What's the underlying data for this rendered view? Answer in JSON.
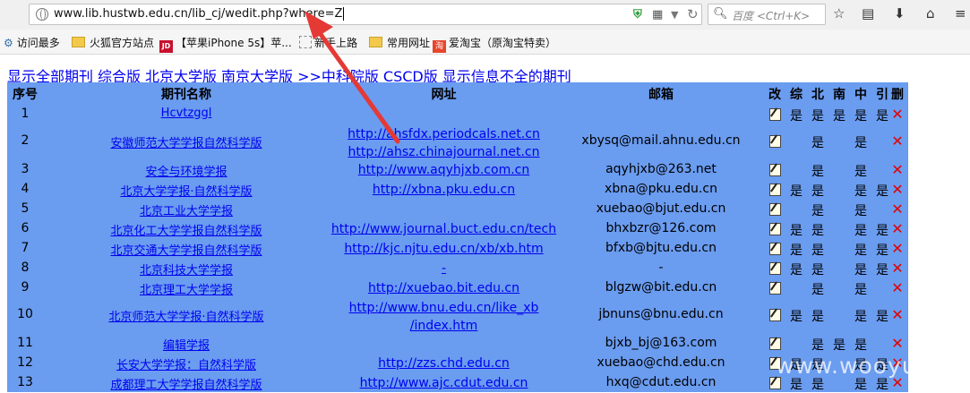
{
  "browser": {
    "url": "www.lib.hustwb.edu.cn/lib_cj/wedit.php?where=Z",
    "search_placeholder": "百度 <Ctrl+K>",
    "icons": [
      "globe-icon",
      "shield-icon",
      "qr-icon",
      "dropdown-icon",
      "reload-icon",
      "search-icon",
      "star-icon",
      "reading-list-icon",
      "download-icon",
      "home-icon",
      "menu-icon"
    ]
  },
  "bookmarks": [
    {
      "label": "访问最多",
      "icon": "gear-icon"
    },
    {
      "label": "火狐官方站点",
      "icon": "folder-icon"
    },
    {
      "label": "【苹果iPhone 5s】苹...",
      "icon": "jd-icon"
    },
    {
      "label": "新手上路",
      "icon": "page-icon"
    },
    {
      "label": "常用网址",
      "icon": "folder-icon"
    },
    {
      "label": "爱淘宝（原淘宝特卖）",
      "icon": "taobao-icon"
    }
  ],
  "filters": [
    "显示全部期刊",
    "综合版",
    "北京大学版",
    "南京大学版",
    ">>中科院版",
    "CSCD版",
    "显示信息不全的期刊"
  ],
  "columns": [
    "序号",
    "期刊名称",
    "网址",
    "邮箱",
    "改",
    "综",
    "北",
    "南",
    "中",
    "引",
    "删"
  ],
  "rows": [
    {
      "no": "1",
      "name": "Hcvtzggl",
      "url": [
        ""
      ],
      "email": "",
      "zh": "是",
      "bei": "是",
      "nan": "是",
      "zk": "是",
      "yin": "是"
    },
    {
      "no": "2",
      "name": "安徽师范大学学报自然科学版",
      "url": [
        "http://ahsfdx.periodcals.net.cn",
        "http://ahsz.chinajournal.net.cn"
      ],
      "email": "xbysq@mail.ahnu.edu.cn",
      "zh": "",
      "bei": "是",
      "nan": "",
      "zk": "是",
      "yin": ""
    },
    {
      "no": "3",
      "name": "安全与环境学报",
      "url": [
        "http://www.aqyhjxb.com.cn"
      ],
      "email": "aqyhjxb@263.net",
      "zh": "",
      "bei": "是",
      "nan": "",
      "zk": "是",
      "yin": ""
    },
    {
      "no": "4",
      "name": "北京大学学报·自然科学版",
      "url": [
        "http://xbna.pku.edu.cn"
      ],
      "email": "xbna@pku.edu.cn",
      "zh": "是",
      "bei": "是",
      "nan": "",
      "zk": "是",
      "yin": "是"
    },
    {
      "no": "5",
      "name": "北京工业大学学报",
      "url": [
        ""
      ],
      "email": "xuebao@bjut.edu.cn",
      "zh": "",
      "bei": "是",
      "nan": "",
      "zk": "是",
      "yin": ""
    },
    {
      "no": "6",
      "name": "北京化工大学学报自然科学版",
      "url": [
        "http://www.journal.buct.edu.cn/tech"
      ],
      "email": "bhxbzr@126.com",
      "zh": "是",
      "bei": "是",
      "nan": "",
      "zk": "是",
      "yin": "是"
    },
    {
      "no": "7",
      "name": "北京交通大学学报自然科学版",
      "url": [
        "http://kjc.njtu.edu.cn/xb/xb.htm"
      ],
      "email": "bfxb@bjtu.edu.cn",
      "zh": "是",
      "bei": "是",
      "nan": "",
      "zk": "是",
      "yin": "是"
    },
    {
      "no": "8",
      "name": "北京科技大学学报",
      "url": [
        "-"
      ],
      "email": "-",
      "zh": "是",
      "bei": "是",
      "nan": "",
      "zk": "是",
      "yin": "是"
    },
    {
      "no": "9",
      "name": "北京理工大学学报",
      "url": [
        "http://xuebao.bit.edu.cn"
      ],
      "email": "blgzw@bit.edu.cn",
      "zh": "",
      "bei": "是",
      "nan": "",
      "zk": "是",
      "yin": ""
    },
    {
      "no": "10",
      "name": "北京师范大学学报·自然科学版",
      "url": [
        "http://www.bnu.edu.cn/like_xb",
        "/index.htm"
      ],
      "email": "jbnuns@bnu.edu.cn",
      "zh": "是",
      "bei": "是",
      "nan": "",
      "zk": "是",
      "yin": "是"
    },
    {
      "no": "11",
      "name": "编辑学报",
      "url": [
        ""
      ],
      "email": "bjxb_bj@163.com",
      "zh": "",
      "bei": "是",
      "nan": "是",
      "zk": "是",
      "yin": ""
    },
    {
      "no": "12",
      "name": "长安大学学报：自然科学版",
      "url": [
        "http://zzs.chd.edu.cn"
      ],
      "email": "xuebao@chd.edu.cn",
      "zh": "是",
      "bei": "是",
      "nan": "",
      "zk": "是",
      "yin": "是"
    },
    {
      "no": "13",
      "name": "成都理工大学学报自然科学版",
      "url": [
        "http://www.ajc.cdut.edu.cn"
      ],
      "email": "hxq@cdut.edu.cn",
      "zh": "是",
      "bei": "是",
      "nan": "",
      "zk": "是",
      "yin": "是"
    }
  ],
  "watermark": "www.wooyun.org",
  "colors": {
    "table_bg": "#6a9cf0",
    "link": "#0000ee",
    "delete": "#e00000",
    "arrow": "#e53935"
  }
}
